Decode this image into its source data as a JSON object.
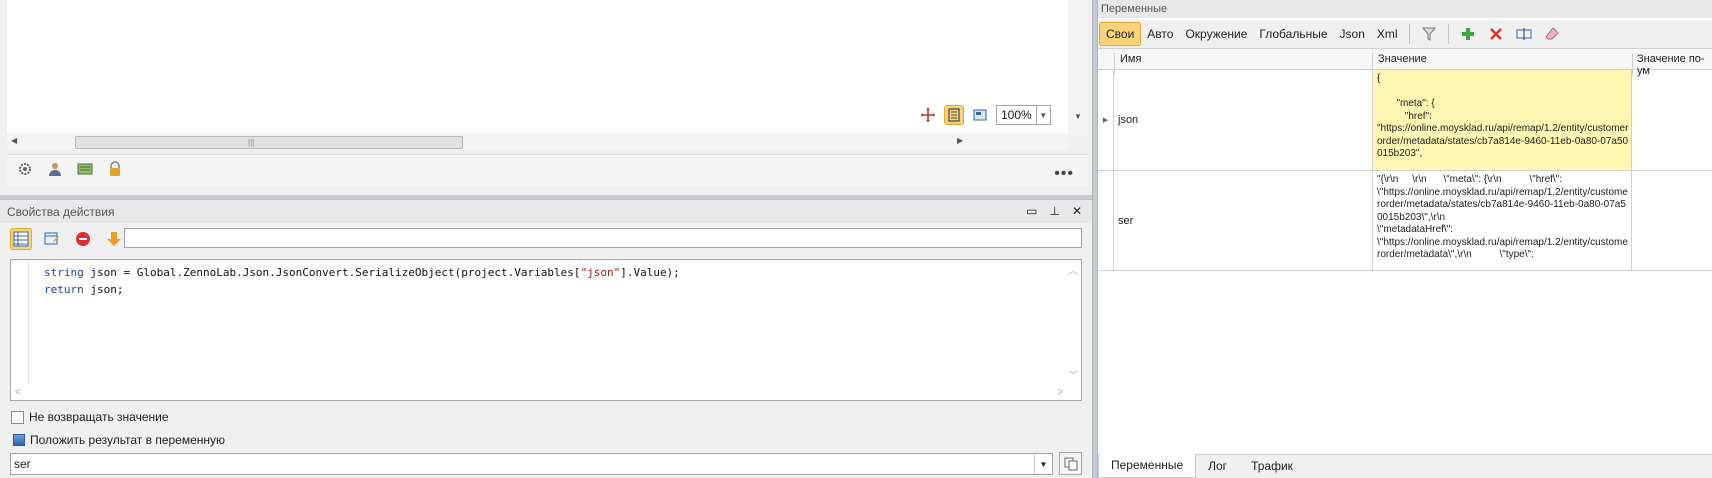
{
  "canvas": {
    "zoom_value": "100%"
  },
  "action_panel": {
    "title": "Свойства действия",
    "code_lines": [
      {
        "keyword": "string",
        "rest": " json = Global.ZennoLab.Json.JsonConvert.SerializeObject(project.Variables[",
        "string": "\"json\"",
        "tail": "].Value);"
      },
      {
        "keyword": "return",
        "rest": " json;",
        "string": "",
        "tail": ""
      }
    ],
    "no_return_label": "Не возвращать значение",
    "put_result_label": "Положить результат в переменную",
    "result_variable": "ser"
  },
  "variables_panel": {
    "title": "Переменные",
    "tabs": [
      "Свои",
      "Авто",
      "Окружение",
      "Глобальные",
      "Json",
      "Xml"
    ],
    "columns": {
      "name": "Имя",
      "value": "Значение",
      "default": "Значение по-ум"
    },
    "rows": [
      {
        "name": "json",
        "value": "{\n\n       \"meta\": {\n          \"href\":\n\"https://online.moysklad.ru/api/remap/1.2/entity/customerorder/metadata/states/cb7a814e-9460-11eb-0a80-07a50015b203\","
      },
      {
        "name": "ser",
        "value": "\"{\\r\\n     \\r\\n      \\\"meta\\\": {\\r\\n          \\\"href\\\":\n\\\"https://online.moysklad.ru/api/remap/1.2/entity/customerorder/metadata/states/cb7a814e-9460-11eb-0a80-07a50015b203\\\",\\r\\n\n\\\"metadataHref\\\":\n\\\"https://online.moysklad.ru/api/remap/1.2/entity/customerorder/metadata\\\",\\r\\n          \\\"type\\\":"
      }
    ],
    "bottom_tabs": [
      "Переменные",
      "Лог",
      "Трафик"
    ]
  },
  "colors": {
    "accent": "#f8d37a",
    "selected_cell": "#fdf7b3"
  }
}
